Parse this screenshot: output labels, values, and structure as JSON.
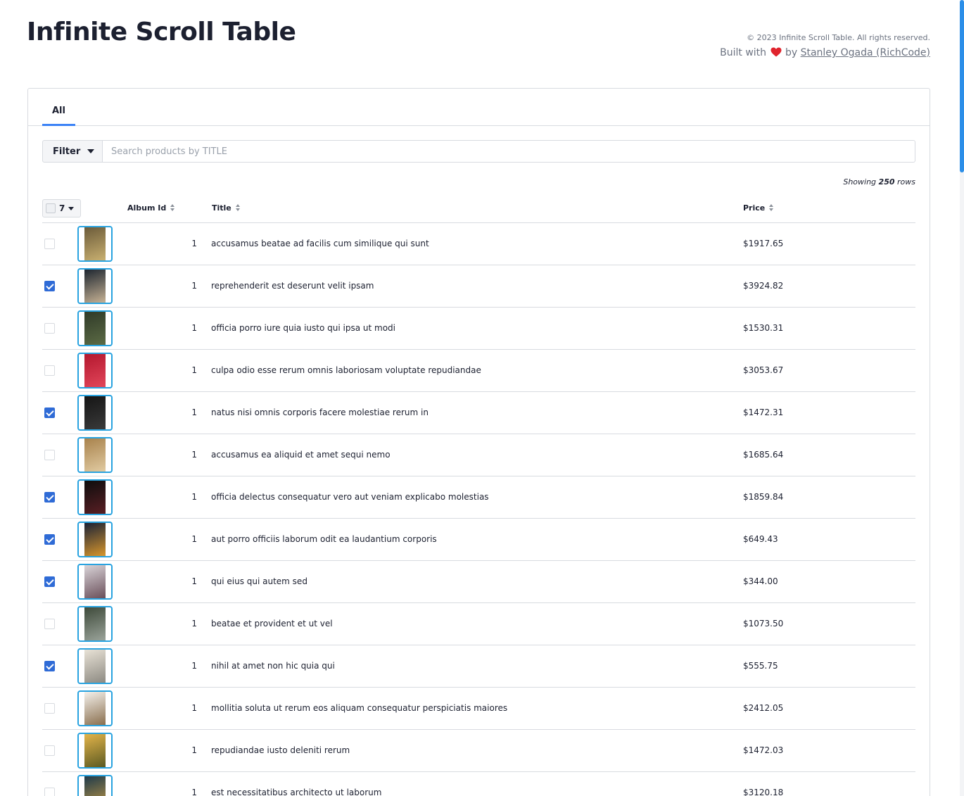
{
  "header": {
    "title": "Infinite Scroll Table",
    "copyright": "© 2023 Infinite Scroll Table. All rights reserved.",
    "built_prefix": "Built with",
    "built_by": "by",
    "author_link": "Stanley Ogada (RichCode)"
  },
  "tabs": [
    {
      "label": "All",
      "active": true
    }
  ],
  "filter": {
    "button_label": "Filter",
    "search_placeholder": "Search products by TITLE",
    "search_value": ""
  },
  "summary": {
    "prefix": "Showing",
    "count": "250",
    "suffix": "rows"
  },
  "table": {
    "selected_count": "7",
    "columns": [
      {
        "label": "Album Id"
      },
      {
        "label": "Title"
      },
      {
        "label": "Price"
      }
    ],
    "rows": [
      {
        "checked": false,
        "thumb": [
          "#6b5b3a",
          "#c9b070"
        ],
        "album_id": "1",
        "title": "accusamus beatae ad facilis cum similique qui sunt",
        "price": "$1917.65"
      },
      {
        "checked": true,
        "thumb": [
          "#1d2630",
          "#c7b294"
        ],
        "album_id": "1",
        "title": "reprehenderit est deserunt velit ipsam",
        "price": "$3924.82"
      },
      {
        "checked": false,
        "thumb": [
          "#2f3a28",
          "#5c6b45"
        ],
        "album_id": "1",
        "title": "officia porro iure quia iusto qui ipsa ut modi",
        "price": "$1530.31"
      },
      {
        "checked": false,
        "thumb": [
          "#b3172e",
          "#e2465a"
        ],
        "album_id": "1",
        "title": "culpa odio esse rerum omnis laboriosam voluptate repudiandae",
        "price": "$3053.67"
      },
      {
        "checked": true,
        "thumb": [
          "#151515",
          "#3a3a3a"
        ],
        "album_id": "1",
        "title": "natus nisi omnis corporis facere molestiae rerum in",
        "price": "$1472.31"
      },
      {
        "checked": false,
        "thumb": [
          "#a8824c",
          "#e1cba2"
        ],
        "album_id": "1",
        "title": "accusamus ea aliquid et amet sequi nemo",
        "price": "$1685.64"
      },
      {
        "checked": true,
        "thumb": [
          "#0d0d0d",
          "#5a1f24"
        ],
        "album_id": "1",
        "title": "officia delectus consequatur vero aut veniam explicabo molestias",
        "price": "$1859.84"
      },
      {
        "checked": true,
        "thumb": [
          "#1a2236",
          "#d8962c"
        ],
        "album_id": "1",
        "title": "aut porro officiis laborum odit ea laudantium corporis",
        "price": "$649.43"
      },
      {
        "checked": true,
        "thumb": [
          "#d9d4d8",
          "#6a4f5a"
        ],
        "album_id": "1",
        "title": "qui eius qui autem sed",
        "price": "$344.00"
      },
      {
        "checked": false,
        "thumb": [
          "#3e4a3a",
          "#9aa39a"
        ],
        "album_id": "1",
        "title": "beatae et provident et ut vel",
        "price": "$1073.50"
      },
      {
        "checked": true,
        "thumb": [
          "#e8e2d6",
          "#8d8a82"
        ],
        "album_id": "1",
        "title": "nihil at amet non hic quia qui",
        "price": "$555.75"
      },
      {
        "checked": false,
        "thumb": [
          "#f4f1ec",
          "#8a6f4e"
        ],
        "album_id": "1",
        "title": "mollitia soluta ut rerum eos aliquam consequatur perspiciatis maiores",
        "price": "$2412.05"
      },
      {
        "checked": false,
        "thumb": [
          "#e3b44a",
          "#5c5a22"
        ],
        "album_id": "1",
        "title": "repudiandae iusto deleniti rerum",
        "price": "$1472.03"
      },
      {
        "checked": false,
        "thumb": [
          "#1e3a4a",
          "#c59a45"
        ],
        "album_id": "1",
        "title": "est necessitatibus architecto ut laborum",
        "price": "$3120.18"
      }
    ]
  },
  "colors": {
    "accent": "#3b82f6",
    "checkbox_checked": "#2f6bd6",
    "thumb_border": "#29a3e0",
    "heart": "#e0242d"
  }
}
